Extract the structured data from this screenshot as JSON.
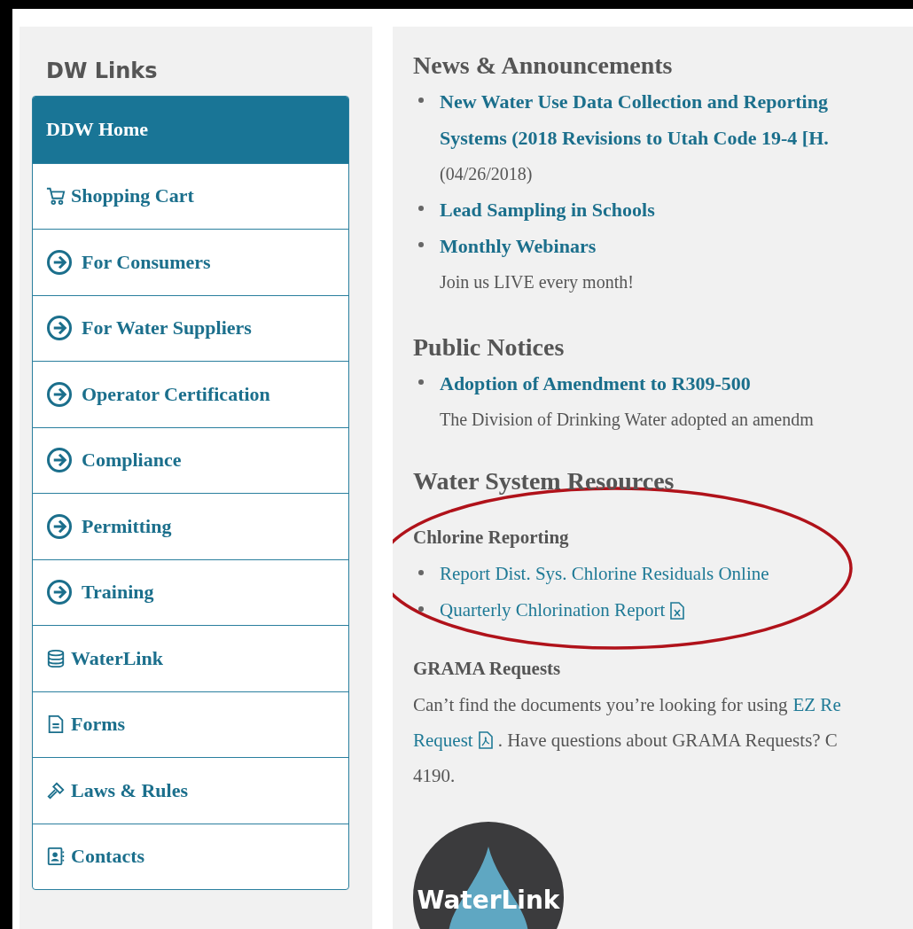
{
  "sidebar": {
    "title": "DW Links",
    "items": [
      {
        "label": "DDW Home",
        "kind": "home",
        "selected": true
      },
      {
        "label": "Shopping Cart",
        "kind": "cart",
        "selected": false
      },
      {
        "label": "For Consumers",
        "kind": "arrow",
        "selected": false
      },
      {
        "label": "For Water Suppliers",
        "kind": "arrow",
        "selected": false
      },
      {
        "label": "Operator Certification",
        "kind": "arrow",
        "selected": false
      },
      {
        "label": "Compliance",
        "kind": "arrow",
        "selected": false
      },
      {
        "label": "Permitting",
        "kind": "arrow",
        "selected": false
      },
      {
        "label": "Training",
        "kind": "arrow",
        "selected": false
      },
      {
        "label": "WaterLink",
        "kind": "database",
        "selected": false
      },
      {
        "label": "Forms",
        "kind": "document",
        "selected": false
      },
      {
        "label": "Laws & Rules",
        "kind": "gavel",
        "selected": false
      },
      {
        "label": "Contacts",
        "kind": "contact",
        "selected": false
      }
    ]
  },
  "news": {
    "title": "News & Announcements",
    "items": [
      {
        "link_lines": [
          "New Water Use Data Collection and Reporting",
          "Systems (2018 Revisions to Utah Code 19-4 [H."
        ],
        "note": "(04/26/2018)"
      },
      {
        "link_lines": [
          "Lead Sampling in Schools"
        ]
      },
      {
        "link_lines": [
          "Monthly Webinars"
        ],
        "note": "Join us LIVE every month!"
      }
    ]
  },
  "notices": {
    "title": "Public Notices",
    "items": [
      {
        "link_lines": [
          "Adoption of Amendment to R309-500"
        ],
        "note": "The Division of Drinking Water adopted an amendm"
      }
    ]
  },
  "resources": {
    "title": "Water System Resources",
    "chlorine": {
      "title": "Chlorine Reporting",
      "links": [
        {
          "label": "Report Dist. Sys. Chlorine Residuals Online",
          "kind": "plain"
        },
        {
          "label": "Quarterly Chlorination Report",
          "kind": "spreadsheet"
        }
      ]
    },
    "grama": {
      "title": "GRAMA Requests",
      "line1_text": "Can’t find the documents you’re looking for using",
      "line1_link": "EZ Re",
      "line2_link": {
        "label": "Request",
        "kind": "pdf"
      },
      "line2_text": ". Have questions about GRAMA Requests? C",
      "line3_text": "4190."
    }
  },
  "logo": {
    "text": "WaterLink"
  }
}
